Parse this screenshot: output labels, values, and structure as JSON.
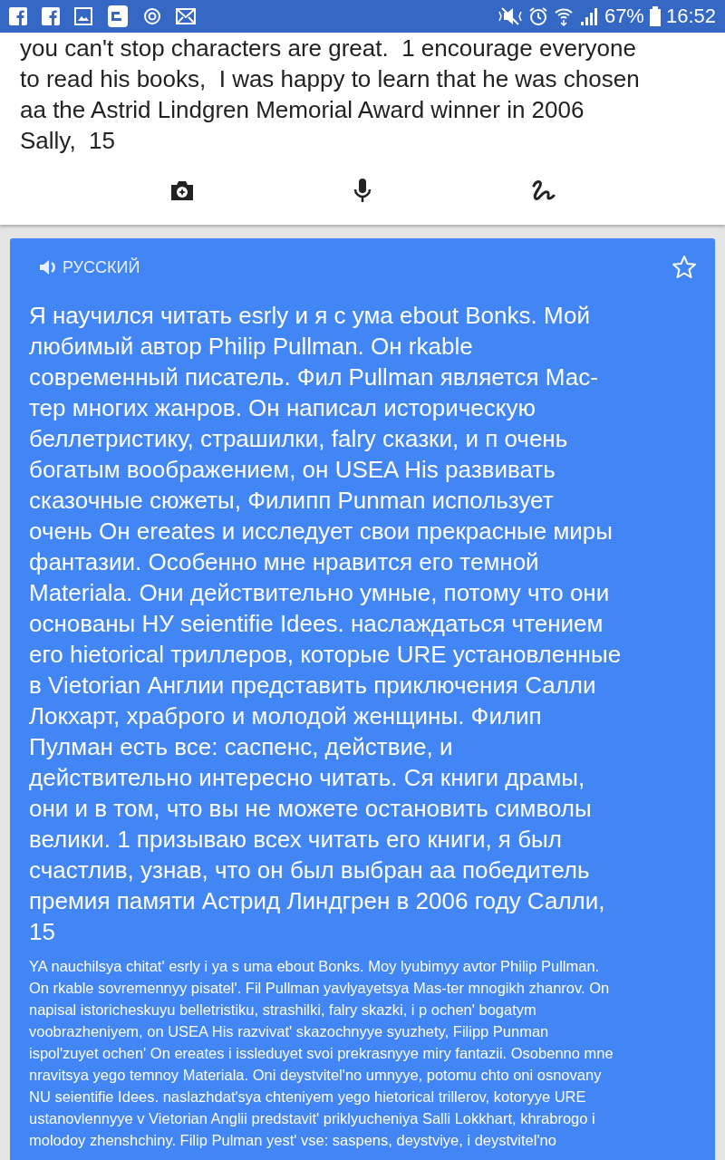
{
  "status_bar": {
    "battery": "67%",
    "time": "16:52"
  },
  "source": {
    "text": "you can't stop characters are great.  1 encourage everyone\nto read his books,  I was happy to learn that he was chosen\naa the Astrid Lindgren Memorial Award winner in 2006\nSally,  15"
  },
  "translation": {
    "language": "РУССКИЙ",
    "starred": false,
    "text": "Я научился читать esrly и я с ума ebout Bonks. Мой\nлюбимый автор Philip Pullman. Он rkable\nсовременный писатель. Фил Pullman является Мас-\nтер многих жанров. Он написал историческую\nбеллетристику, страшилки, falry сказки, и п очень\nбогатым воображением, он USEA His развивать\nсказочные сюжеты, Филипп Punman использует\nочень Он ereates и исследует свои прекрасные миры\nфантазии. Особенно мне нравится его темной\nMateriala. Они действительно умные, потому что они\nоснованы НУ seientifie Idees. наслаждаться чтением\nего hietorical триллеров, которые URE установленные\nв Vietorian Англии представить приключения Салли\nЛокхарт, храброго и молодой женщины. Филип\nПулман есть все: саспенс, действие, и\nдействительно интересно читать. Ся книги драмы,\nони и в том, что вы не можете остановить символы\nвелики. 1 призываю всех читать его книги, я был\nсчастлив, узнав, что он был выбран аа победитель\nпремия памяти Астрид Линдгрен в 2006 году Салли,\n15",
    "transliteration": "YA nauchilsya chitat' esrly i ya s uma ebout Bonks. Moy lyubimyy avtor Philip Pullman.\nOn rkable sovremennyy pisatel'. Fil Pullman yavlyayetsya Mas-ter mnogikh zhanrov. On\nnapisal istoricheskuyu belletristiku, strashilki, falry skazki, i p ochen' bogatym\nvoobrazheniyem, on USEA His razvivat' skazochnyye syuzhety, Filipp Punman\nispol'zuyet ochen' On ereates i issleduyet svoi prekrasnyye miry fantazii. Osobenno mne\nnravitsya yego temnoy Materiala. Oni deystvitel'no umnyye, potomu chto oni osnovany\nNU seientifie Idees. naslazhdat'sya chteniyem yego hietorical trillerov, kotoryye URE\nustanovlennyye v Vietorian Anglii predstavit' priklyucheniya Salli Lokkhart, khrabrogo i\nmolodoy zhenshchiny. Filip Pulman yest' vse: saspens, deystviye, i deystvitel'no"
  }
}
